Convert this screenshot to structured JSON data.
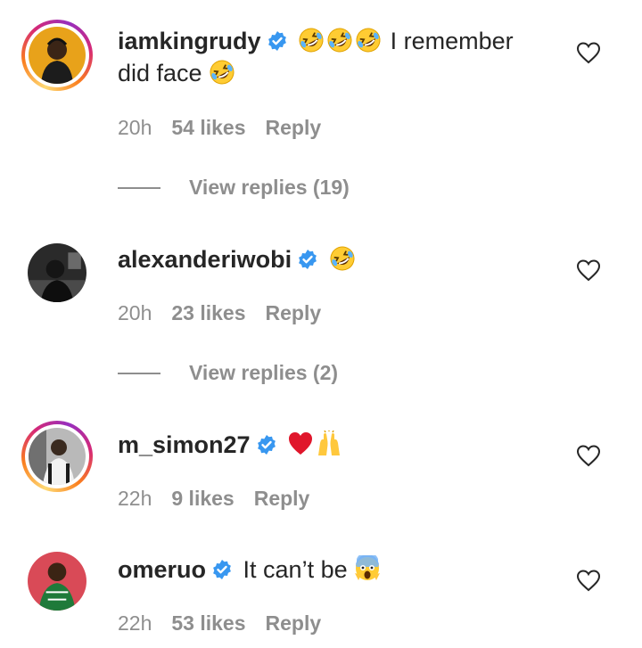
{
  "comments": [
    {
      "username": "iamkingrudy",
      "verified": true,
      "text_after": "I remember did face",
      "text_line1": "I remember",
      "text_line2": "did face",
      "time": "20h",
      "likes": "54 likes",
      "reply": "Reply",
      "view_replies": "View replies (19)"
    },
    {
      "username": "alexanderiwobi",
      "verified": true,
      "time": "20h",
      "likes": "23 likes",
      "reply": "Reply",
      "view_replies": "View replies (2)"
    },
    {
      "username": "m_simon27",
      "verified": true,
      "time": "22h",
      "likes": "9 likes",
      "reply": "Reply"
    },
    {
      "username": "omeruo",
      "verified": true,
      "text": "It can’t be",
      "time": "22h",
      "likes": "53 likes",
      "reply": "Reply"
    }
  ],
  "colors": {
    "verified_blue": "#3897f0",
    "meta_gray": "#8e8e8e",
    "text": "#262626"
  },
  "icons": {
    "like": "heart-outline-icon",
    "laugh": "rolling-on-floor-laughing-emoji",
    "heart": "red-heart-emoji",
    "praise": "raising-hands-emoji",
    "scream": "face-screaming-in-fear-emoji"
  }
}
